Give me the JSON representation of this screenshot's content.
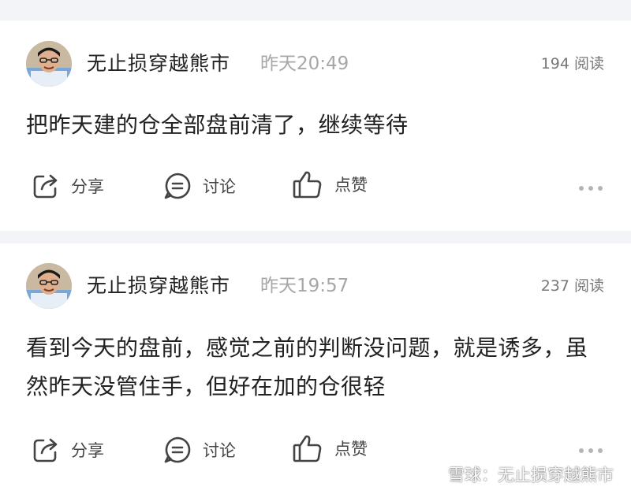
{
  "posts": [
    {
      "author": "无止损穿越熊市",
      "time": "昨天20:49",
      "reads": "194 阅读",
      "content": "把昨天建的仓全部盘前清了，继续等待",
      "actions": {
        "share": "分享",
        "discuss": "讨论",
        "like": "点赞"
      }
    },
    {
      "author": "无止损穿越熊市",
      "time": "昨天19:57",
      "reads": "237 阅读",
      "content": "看到今天的盘前，感觉之前的判断没问题，就是诱多，虽然昨天没管住手，但好在加的仓很轻",
      "actions": {
        "share": "分享",
        "discuss": "讨论",
        "like": "点赞"
      }
    }
  ],
  "watermark": "雪球：无止损穿越熊市",
  "icons": [
    "share-icon",
    "discuss-icon",
    "like-icon",
    "more-icon",
    "snowball-logo-icon"
  ]
}
